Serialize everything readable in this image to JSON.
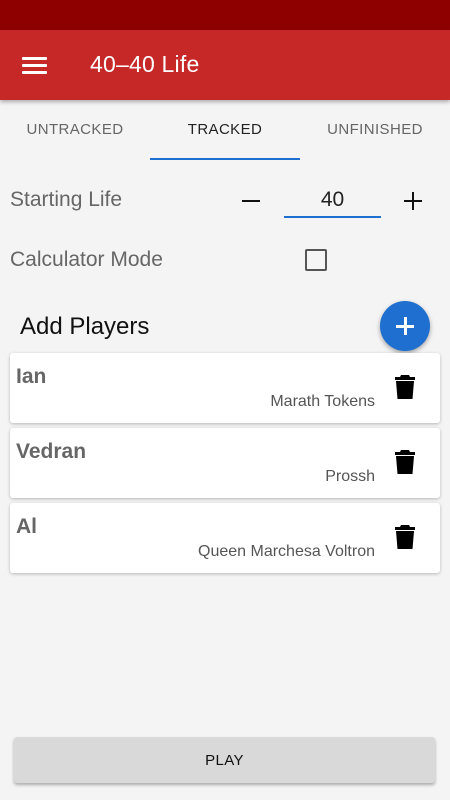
{
  "app_bar": {
    "title": "40–40 Life",
    "menu_icon": "hamburger-menu-icon"
  },
  "tabs": [
    {
      "label": "UNTRACKED",
      "active": false
    },
    {
      "label": "TRACKED",
      "active": true
    },
    {
      "label": "UNFINISHED",
      "active": false
    }
  ],
  "settings": {
    "starting_life_label": "Starting Life",
    "starting_life_value": "40",
    "calculator_mode_label": "Calculator Mode",
    "calculator_mode_checked": false
  },
  "players_section": {
    "title": "Add Players",
    "add_icon": "plus-icon"
  },
  "players": [
    {
      "name": "Ian",
      "deck": "Marath Tokens"
    },
    {
      "name": "Vedran",
      "deck": "Prossh"
    },
    {
      "name": "Al",
      "deck": "Queen Marchesa Voltron"
    }
  ],
  "footer": {
    "play_label": "PLAY"
  },
  "colors": {
    "primary": "#c62828",
    "primary_dark": "#8e0000",
    "accent": "#1e6fd0"
  }
}
